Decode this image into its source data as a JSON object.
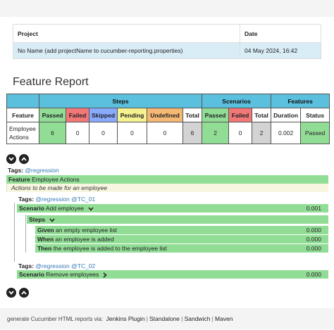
{
  "project": {
    "header_project": "Project",
    "header_date": "Date",
    "name": "No Name (add projectName to cucumber-reporting.properties)",
    "date": "04 May 2024, 16:42"
  },
  "page_title": "Feature Report",
  "stats": {
    "groups": {
      "steps": "Steps",
      "scenarios": "Scenarios",
      "features": "Features"
    },
    "headers": {
      "feature": "Feature",
      "passed": "Passed",
      "failed": "Failed",
      "skipped": "Skipped",
      "pending": "Pending",
      "undefined": "Undefined",
      "total": "Total",
      "sc_passed": "Passed",
      "sc_failed": "Failed",
      "sc_total": "Total",
      "duration": "Duration",
      "status": "Status"
    },
    "row": {
      "feature_line1": "Employee",
      "feature_line2": "Actions",
      "steps_passed": "6",
      "steps_failed": "0",
      "steps_skipped": "0",
      "steps_pending": "0",
      "steps_undefined": "0",
      "steps_total": "6",
      "sc_passed": "2",
      "sc_failed": "0",
      "sc_total": "2",
      "duration": "0.002",
      "status": "Passed"
    }
  },
  "feature": {
    "tags_label": "Tags:",
    "tag": "@regression",
    "keyword": "Feature",
    "name": "Employee Actions",
    "description": "Actions to be made for an employee"
  },
  "scenarios": [
    {
      "tags_label": "Tags:",
      "tag1": "@regression",
      "tag2": "@TC_01",
      "keyword": "Scenario",
      "name": "Add employee",
      "duration": "0.001",
      "steps_label": "Steps",
      "steps": [
        {
          "keyword": "Given",
          "text": "an empty employee list",
          "duration": "0.000"
        },
        {
          "keyword": "When",
          "text": "an employee is added",
          "duration": "0.000"
        },
        {
          "keyword": "Then",
          "text": "the employee is added to the employee list",
          "duration": "0.000"
        }
      ]
    },
    {
      "tags_label": "Tags:",
      "tag1": "@regression",
      "tag2": "@TC_02",
      "keyword": "Scenario",
      "name": "Remove employees",
      "duration": "0.000"
    }
  ],
  "footer": {
    "text": "generate Cucumber HTML reports via:",
    "links": [
      "Jenkins Plugin",
      "Standalone",
      "Sandwich",
      "Maven"
    ]
  },
  "icons": {
    "expand": "chevron-down-circle-icon",
    "collapse": "chevron-up-circle-icon",
    "scenario_open": "chevron-down-icon",
    "scenario_closed": "chevron-right-icon"
  },
  "colors": {
    "passed": "#92dd96",
    "failed": "#f27878",
    "skipped": "#88aaff",
    "pending": "#f5f28f",
    "undefined": "#f5b975",
    "header_blue": "#5bc0de",
    "project_row": "#d9edf7"
  }
}
